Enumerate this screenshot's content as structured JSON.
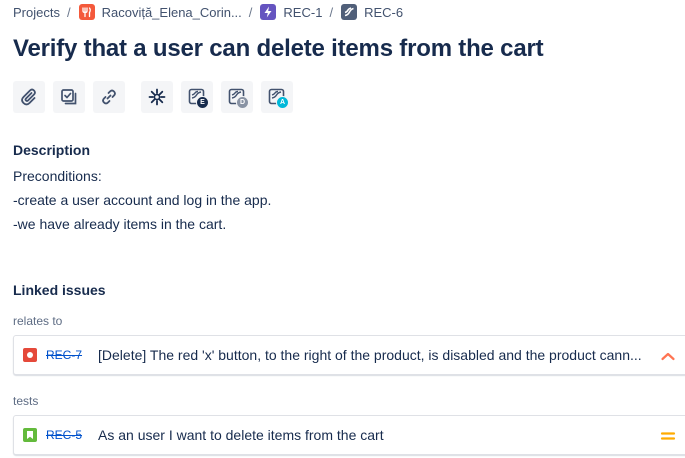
{
  "breadcrumb": {
    "items": [
      {
        "label": "Projects"
      },
      {
        "label": "Racoviță_Elena_Corin..."
      },
      {
        "label": "REC-1"
      },
      {
        "label": "REC-6"
      }
    ],
    "separator": "/"
  },
  "issue": {
    "title": "Verify that a user can delete items from the cart"
  },
  "toolbar": {
    "buttons": [
      {
        "icon": "attachment-icon"
      },
      {
        "icon": "create-subtask-icon"
      },
      {
        "icon": "link-issue-icon"
      },
      {
        "icon": "app-addon-icon"
      },
      {
        "icon": "test-execution-icon",
        "badge": "E"
      },
      {
        "icon": "test-defect-icon",
        "badge": "D"
      },
      {
        "icon": "test-action-icon",
        "badge": "A"
      }
    ]
  },
  "description": {
    "heading": "Description",
    "lines": [
      "Preconditions:",
      "-create a user account and log in the app.",
      "-we have already items in the cart."
    ]
  },
  "linked_issues": {
    "heading": "Linked issues",
    "groups": [
      {
        "relation": "relates to",
        "issue": {
          "type": "bug",
          "key": "REC-7",
          "summary": "[Delete] The red 'x' button, to the right of the product, is disabled and the product cann...",
          "priority": "high"
        }
      },
      {
        "relation": "tests",
        "issue": {
          "type": "story",
          "key": "REC-5",
          "summary": "As an user I want to delete items from the cart",
          "priority": "medium"
        }
      }
    ]
  },
  "colors": {
    "bug": "#e5493a",
    "story": "#63ba3c",
    "priority_high": "#ff7452",
    "priority_medium": "#ffab00",
    "link": "#0052cc",
    "text": "#172b4d"
  }
}
